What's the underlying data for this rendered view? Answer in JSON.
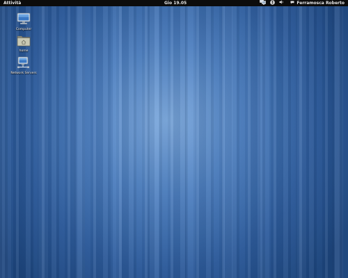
{
  "topbar": {
    "activities_label": "Attività",
    "clock_label": "Gio 19.05",
    "tray": {
      "network_icon": "network-icon",
      "accessibility_icon": "accessibility-icon",
      "volume_icon": "volume-icon"
    },
    "user_name": "Ferramosca Roberto"
  },
  "desktop": {
    "icons": [
      {
        "label": "Computer",
        "icon": "computer-icon"
      },
      {
        "label": "home",
        "icon": "home-folder-icon"
      },
      {
        "label": "Network Servers",
        "icon": "network-servers-icon"
      }
    ]
  },
  "colors": {
    "topbar": "#0c0c0c",
    "wallpaper_light": "#7aa7dc",
    "wallpaper_dark": "#1d467f"
  }
}
